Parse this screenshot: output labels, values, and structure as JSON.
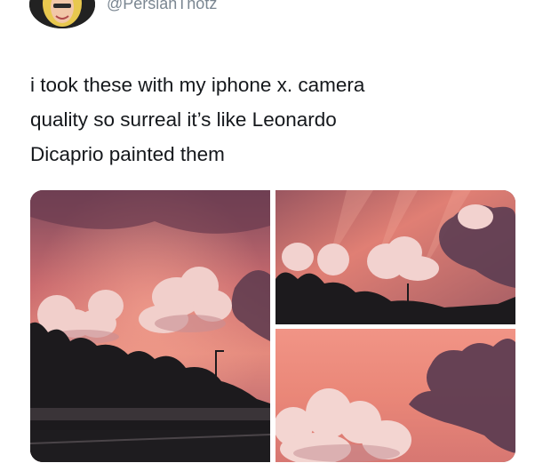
{
  "tweet": {
    "handle": "@PersianThotz",
    "text_line1": "i took these with my iphone x. camera",
    "text_line2": "quality so surreal it’s like Leonardo",
    "text_line3": "Dicaprio painted them"
  },
  "photos": [
    {
      "subject": "pink-sunset-sky-with-clouds-and-trees"
    },
    {
      "subject": "pink-sunset-clouds-over-treeline"
    },
    {
      "subject": "pink-sky-with-dark-storm-cloud"
    }
  ],
  "colors": {
    "sky_pink": "#e9897f",
    "sky_deep": "#8c4b5a",
    "cloud": "#f0c9c6",
    "dark": "#1c1a1d",
    "handle_gray": "#7b8792"
  }
}
